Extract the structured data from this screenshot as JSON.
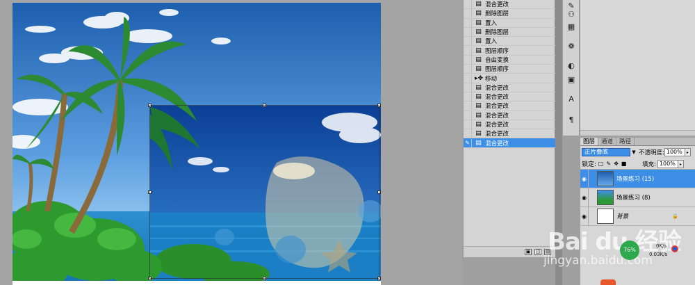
{
  "history": {
    "items": [
      {
        "label": "混合更改",
        "icon": "layer-icon",
        "active": false
      },
      {
        "label": "删除图层",
        "icon": "layer-icon",
        "active": false
      },
      {
        "label": "置入",
        "icon": "layer-icon",
        "active": false
      },
      {
        "label": "删除图层",
        "icon": "layer-icon",
        "active": false
      },
      {
        "label": "置入",
        "icon": "layer-icon",
        "active": false
      },
      {
        "label": "图层顺序",
        "icon": "layer-icon",
        "active": false
      },
      {
        "label": "自由变换",
        "icon": "layer-icon",
        "active": false
      },
      {
        "label": "图层顺序",
        "icon": "layer-icon",
        "active": false
      },
      {
        "label": "移动",
        "icon": "move-icon",
        "active": false
      },
      {
        "label": "混合更改",
        "icon": "layer-icon",
        "active": false
      },
      {
        "label": "混合更改",
        "icon": "layer-icon",
        "active": false
      },
      {
        "label": "混合更改",
        "icon": "layer-icon",
        "active": false
      },
      {
        "label": "混合更改",
        "icon": "layer-icon",
        "active": false
      },
      {
        "label": "混合更改",
        "icon": "layer-icon",
        "active": false
      },
      {
        "label": "混合更改",
        "icon": "layer-icon",
        "active": false
      },
      {
        "label": "混合更改",
        "icon": "layer-icon",
        "active": true
      }
    ]
  },
  "layers_panel": {
    "tabs": [
      "图层",
      "通道",
      "路径"
    ],
    "blend_mode": "正片叠底",
    "opacity_label": "不透明度:",
    "opacity_value": "100%",
    "lock_label": "锁定:",
    "fill_label": "填充:",
    "fill_value": "100%",
    "layers": [
      {
        "name": "场景练习 (15)",
        "active": true,
        "italic": false
      },
      {
        "name": "场景练习 (8)",
        "active": false,
        "italic": false
      },
      {
        "name": "背景",
        "active": false,
        "italic": true
      }
    ]
  },
  "watermark": {
    "logo": "Bai du 经验",
    "url": "jingyan.baidu.com"
  },
  "net_widget": {
    "percent": "76%",
    "up": "0K/s",
    "down": "0.03K/s"
  },
  "colors": {
    "selection": "#3d8ee6",
    "panel_bg": "#d7d7d7",
    "canvas_bg": "#a4a4a4"
  }
}
